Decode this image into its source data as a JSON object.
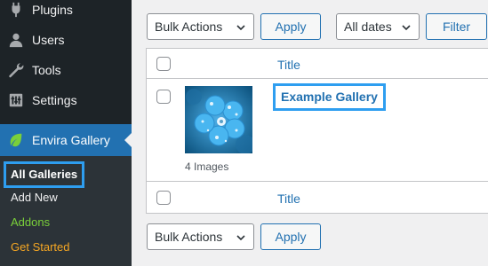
{
  "sidebar": {
    "menu": [
      {
        "label": "Plugins",
        "icon": "plug-icon"
      },
      {
        "label": "Users",
        "icon": "user-icon"
      },
      {
        "label": "Tools",
        "icon": "wrench-icon"
      },
      {
        "label": "Settings",
        "icon": "sliders-icon"
      }
    ],
    "active": {
      "label": "Envira Gallery",
      "icon": "leaf-icon"
    },
    "submenu": [
      {
        "label": "All Galleries"
      },
      {
        "label": "Add New"
      },
      {
        "label": "Addons"
      },
      {
        "label": "Get Started"
      }
    ]
  },
  "toolbar": {
    "bulk_actions": "Bulk Actions",
    "apply": "Apply",
    "dates": "All dates",
    "filter": "Filter"
  },
  "table": {
    "header_title": "Title",
    "footer_title": "Title",
    "rows": [
      {
        "title": "Example Gallery",
        "count": "4 Images"
      }
    ]
  },
  "bottom_toolbar": {
    "bulk_actions": "Bulk Actions",
    "apply": "Apply"
  },
  "colors": {
    "sidebar_bg": "#1d2327",
    "active_bg": "#2271b1",
    "highlight": "#2e9ef0",
    "addons": "#7ad03a",
    "get_started": "#f5a623"
  }
}
